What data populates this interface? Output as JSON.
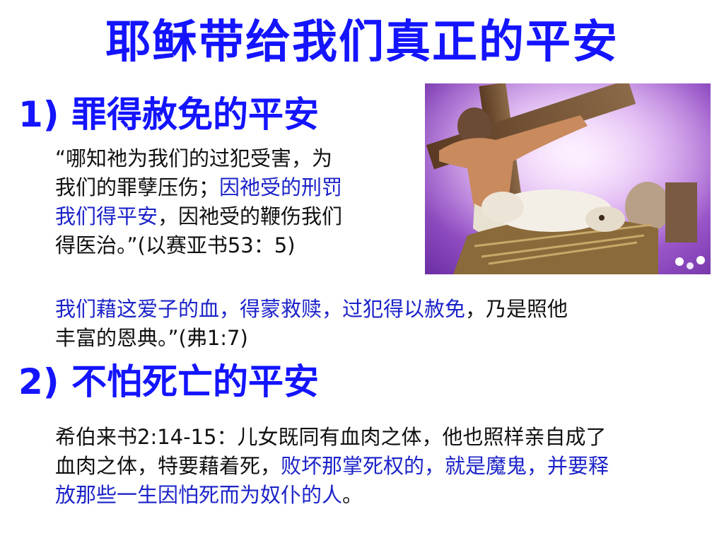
{
  "title": "耶稣带给我们真正的平安",
  "section1": {
    "heading": "1) 罪得赦免的平安",
    "quote": {
      "lines": [
        [
          {
            "text": "“哪知祂为我们的过犯受害，为"
          }
        ],
        [
          {
            "text": "我们的罪孽压伤；"
          },
          {
            "text": "因祂受的刑罚",
            "blue": true
          }
        ],
        [
          {
            "text": "我们得平安",
            "blue": true
          },
          {
            "text": "，因祂受的鞭伤我们"
          }
        ],
        [
          {
            "text": "得医治。”(以赛亚书53：5)"
          }
        ]
      ]
    },
    "verse": {
      "lines": [
        [
          {
            "text": "我们藉这爱子的血，得蒙救赎，过犯得以赦免",
            "blue": true
          },
          {
            "text": "，乃是照他"
          }
        ],
        [
          {
            "text": "丰富的恩典。”(弗1:7)"
          }
        ]
      ]
    }
  },
  "section2": {
    "heading": "2) 不怕死亡的平安",
    "verse": {
      "lines": [
        [
          {
            "text": "希伯来书2:14-15：儿女既同有血肉之体，他也照样亲自成了"
          }
        ],
        [
          {
            "text": "血肉之体，特要藉着死，"
          },
          {
            "text": "败坏那掌死权的，就是魔鬼，并要释",
            "blue": true
          }
        ],
        [
          {
            "text": "放那些一生因怕死而为奴仆的人",
            "blue": true
          },
          {
            "text": "。"
          }
        ]
      ]
    }
  },
  "colors": {
    "heading": "#1414ff",
    "highlight": "#1c23c8",
    "body": "#111111"
  }
}
